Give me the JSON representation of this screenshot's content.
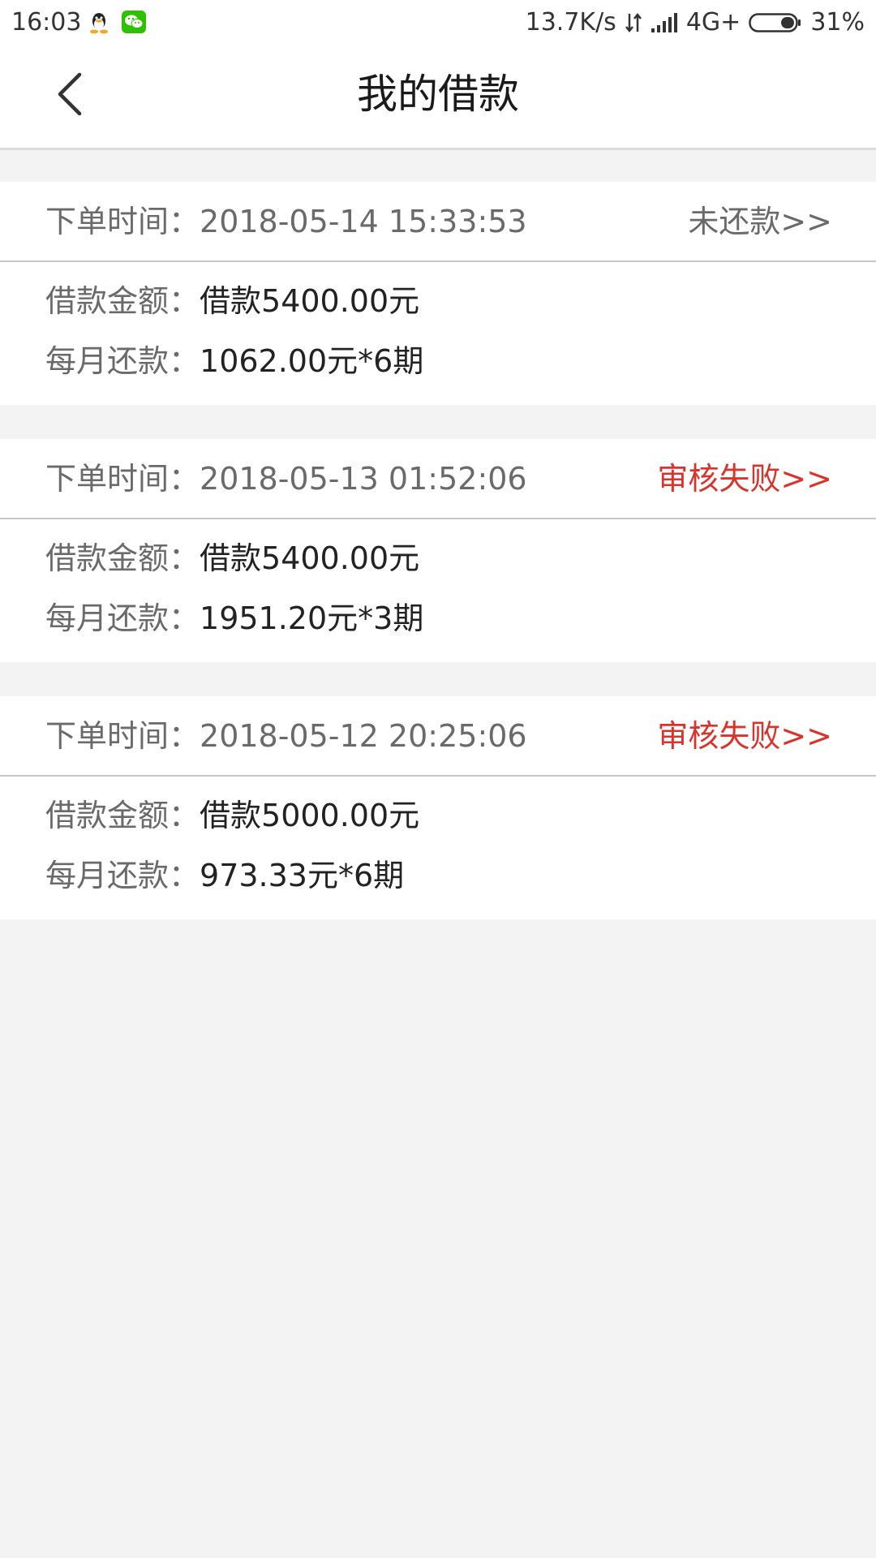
{
  "status_bar": {
    "time": "16:03",
    "network_speed": "13.7K/s",
    "network_type": "4G+",
    "battery": "31%",
    "icons": [
      "qq-icon",
      "wechat-icon",
      "data-transfer-icon",
      "signal-icon",
      "battery-icon"
    ]
  },
  "header": {
    "title": "我的借款",
    "back_icon": "chevron-left-icon"
  },
  "colors": {
    "background": "#f3f3f3",
    "card": "#ffffff",
    "label": "#6a6a6a",
    "value": "#222222",
    "status_pending": "#6a6a6a",
    "status_failed": "#d9342b"
  },
  "loans": [
    {
      "order_time_label": "下单时间：",
      "order_time": "2018-05-14 15:33:53",
      "status": "未还款>>",
      "status_type": "pending",
      "amount_label": "借款金额：",
      "amount": "借款5400.00元",
      "monthly_label": "每月还款：",
      "monthly": "1062.00元*6期"
    },
    {
      "order_time_label": "下单时间：",
      "order_time": "2018-05-13 01:52:06",
      "status": "审核失败>>",
      "status_type": "failed",
      "amount_label": "借款金额：",
      "amount": "借款5400.00元",
      "monthly_label": "每月还款：",
      "monthly": "1951.20元*3期"
    },
    {
      "order_time_label": "下单时间：",
      "order_time": "2018-05-12 20:25:06",
      "status": "审核失败>>",
      "status_type": "failed",
      "amount_label": "借款金额：",
      "amount": "借款5000.00元",
      "monthly_label": "每月还款：",
      "monthly": "973.33元*6期"
    }
  ]
}
